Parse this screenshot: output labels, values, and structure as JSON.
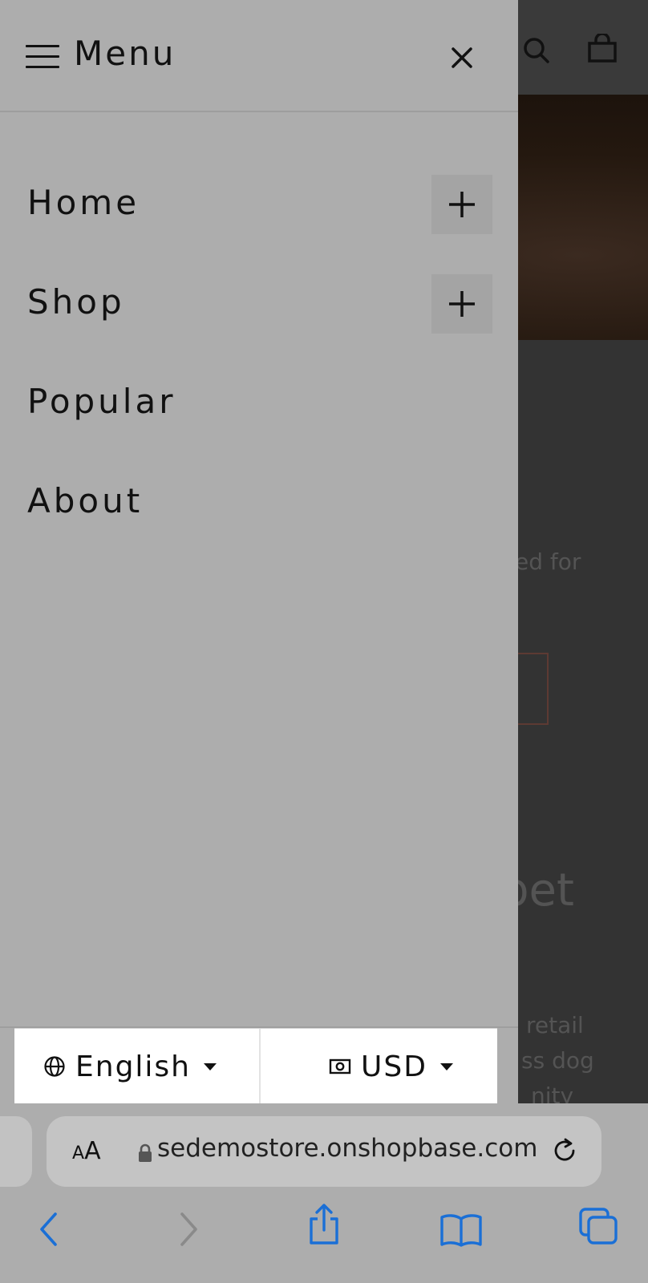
{
  "background_page": {
    "partial_texts": [
      "ed for",
      "pet",
      "retail",
      "ss dog",
      "nity"
    ]
  },
  "drawer": {
    "title": "Menu",
    "nav_items": [
      {
        "label": "Home",
        "expandable": true
      },
      {
        "label": "Shop",
        "expandable": true
      },
      {
        "label": "Popular",
        "expandable": false
      },
      {
        "label": "About",
        "expandable": false
      }
    ]
  },
  "selectors": {
    "language": "English",
    "currency": "USD"
  },
  "browser": {
    "text_size_small": "A",
    "text_size_large": "A",
    "url": "sedemostore.onshopbase.com",
    "accent_color": "#1a6fd6"
  }
}
